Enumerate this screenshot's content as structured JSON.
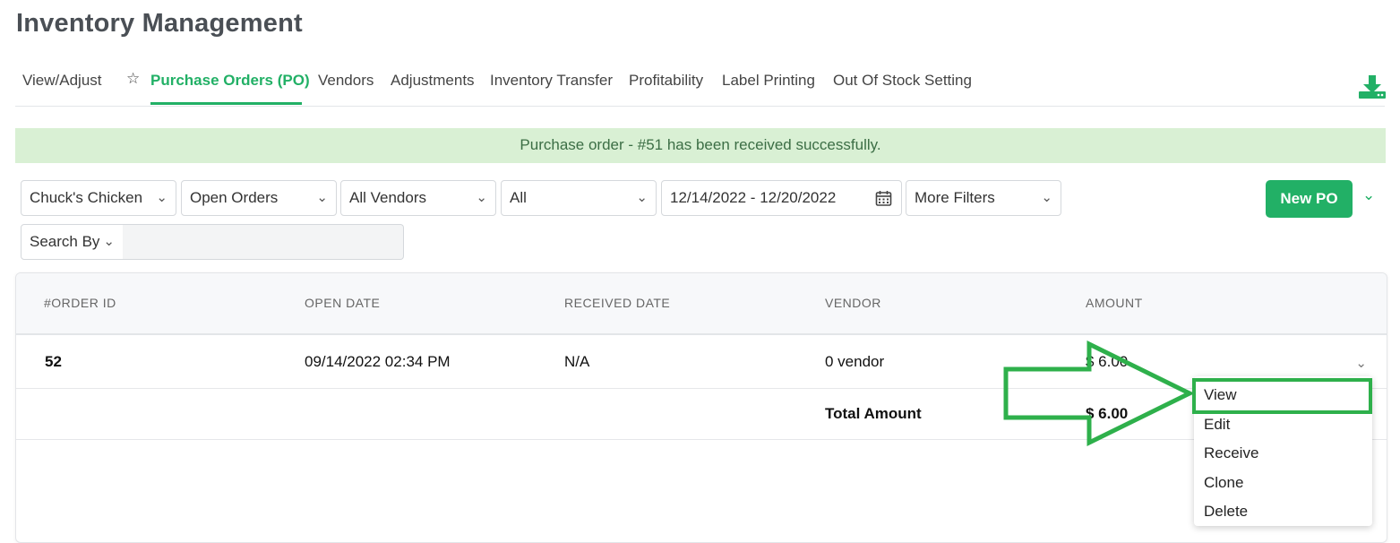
{
  "page": {
    "title": "Inventory Management"
  },
  "tabs": [
    {
      "label": "View/Adjust"
    },
    {
      "label": "Purchase Orders (PO)",
      "active": true,
      "starred": true
    },
    {
      "label": "Vendors"
    },
    {
      "label": "Adjustments"
    },
    {
      "label": "Inventory Transfer"
    },
    {
      "label": "Profitability"
    },
    {
      "label": "Label Printing"
    },
    {
      "label": "Out Of Stock Setting"
    }
  ],
  "icons": {
    "download": "download-icon",
    "star": "star-icon",
    "calendar": "calendar-icon",
    "chevron": "chevron-down-icon"
  },
  "alert": {
    "text": "Purchase order - #51 has been received successfully."
  },
  "filters": {
    "store": "Chuck's Chicken",
    "status": "Open Orders",
    "vendor": "All Vendors",
    "type": "All",
    "date_range": "12/14/2022 - 12/20/2022",
    "more": "More Filters",
    "search_by": "Search By",
    "search_value": ""
  },
  "actions": {
    "new_po": "New PO"
  },
  "table": {
    "headers": [
      "#ORDER ID",
      "OPEN DATE",
      "RECEIVED DATE",
      "VENDOR",
      "AMOUNT"
    ],
    "rows": [
      {
        "order_id": "52",
        "open_date": "09/14/2022 02:34 PM",
        "received_date": "N/A",
        "vendor": "0 vendor",
        "amount": "$ 6.00"
      }
    ],
    "total": {
      "label": "Total Amount",
      "value": "$ 6.00"
    }
  },
  "row_menu": [
    "View",
    "Edit",
    "Receive",
    "Clone",
    "Delete"
  ],
  "colors": {
    "accent": "#22b066",
    "alert_bg": "#d9f0d4",
    "annotation": "#2eb04b"
  }
}
